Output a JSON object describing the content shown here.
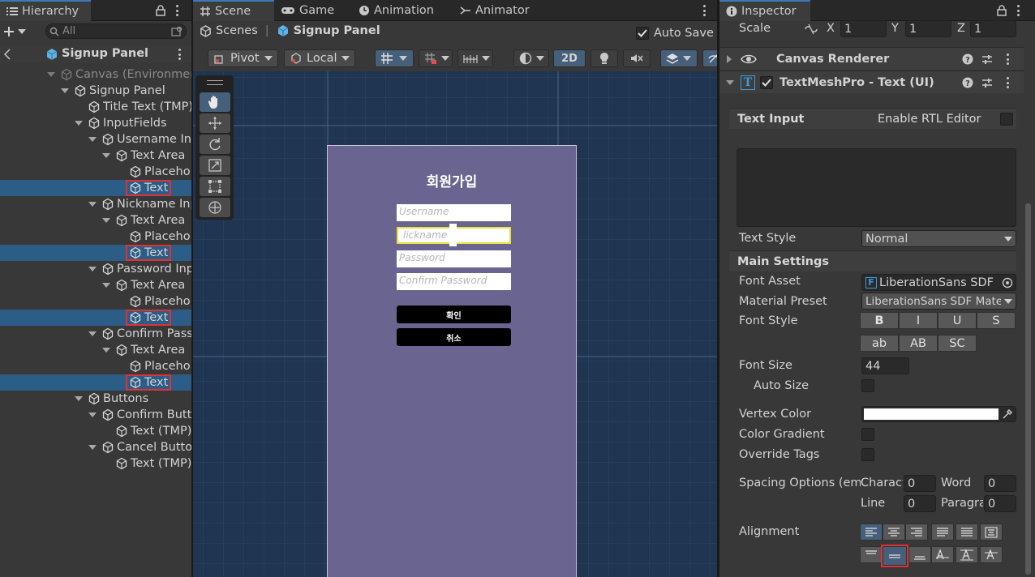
{
  "hierarchy": {
    "tab_label": "Hierarchy",
    "search_placeholder": "All",
    "breadcrumb": "Signup Panel",
    "rows": [
      {
        "label": "Canvas (Environment)",
        "depth": 0
      },
      {
        "label": "Signup Panel",
        "depth": 1
      },
      {
        "label": "Title Text (TMP)",
        "depth": 2
      },
      {
        "label": "InputFields",
        "depth": 2
      },
      {
        "label": "Username Input",
        "depth": 3
      },
      {
        "label": "Text Area",
        "depth": 4
      },
      {
        "label": "Placeholder",
        "depth": 5
      },
      {
        "label": "Text",
        "depth": 5
      },
      {
        "label": "Nickname Input",
        "depth": 3
      },
      {
        "label": "Text Area",
        "depth": 4
      },
      {
        "label": "Placeholder",
        "depth": 5
      },
      {
        "label": "Text",
        "depth": 5
      },
      {
        "label": "Password Input",
        "depth": 3
      },
      {
        "label": "Text Area",
        "depth": 4
      },
      {
        "label": "Placeholder",
        "depth": 5
      },
      {
        "label": "Text",
        "depth": 5
      },
      {
        "label": "Confirm Password",
        "depth": 3
      },
      {
        "label": "Text Area",
        "depth": 4
      },
      {
        "label": "Placeholder",
        "depth": 5
      },
      {
        "label": "Text",
        "depth": 5
      },
      {
        "label": "Buttons",
        "depth": 2
      },
      {
        "label": "Confirm Button",
        "depth": 3
      },
      {
        "label": "Text (TMP)",
        "depth": 4
      },
      {
        "label": "Cancel Button",
        "depth": 3
      },
      {
        "label": "Text (TMP)",
        "depth": 4
      }
    ]
  },
  "scene": {
    "tabs": [
      "Scene",
      "Game",
      "Animation",
      "Animator"
    ],
    "breadcrumb_root": "Scenes",
    "breadcrumb_current": "Signup Panel",
    "auto_save_label": "Auto Save",
    "auto_save_checked": true,
    "pivot_label": "Pivot",
    "local_label": "Local",
    "mode_2d_label": "2D",
    "canvas": {
      "title": "회원가입",
      "inputs": [
        "Username",
        "lickname",
        "Password",
        "Confirm Password"
      ],
      "confirm_button": "확인",
      "cancel_button": "취소"
    }
  },
  "inspector": {
    "tab_label": "Inspector",
    "scale_label": "Scale",
    "scale": {
      "x_label": "X",
      "x": "1",
      "y_label": "Y",
      "y": "1",
      "z_label": "Z",
      "z": "1"
    },
    "canvas_renderer_label": "Canvas Renderer",
    "component_label": "TextMeshPro - Text (UI)",
    "text_input_label": "Text Input",
    "rtl_label": "Enable RTL Editor",
    "text_style_label": "Text Style",
    "text_style_value": "Normal",
    "main_settings_label": "Main Settings",
    "font_asset_label": "Font Asset",
    "font_asset_value": "LiberationSans SDF",
    "material_preset_label": "Material Preset",
    "material_preset_value": "LiberationSans SDF Material",
    "font_style_label": "Font Style",
    "font_style_buttons_row1": [
      "B",
      "I",
      "U",
      "S"
    ],
    "font_style_buttons_row2": [
      "ab",
      "AB",
      "SC"
    ],
    "font_size_label": "Font Size",
    "font_size_value": "44",
    "auto_size_label": "Auto Size",
    "vertex_color_label": "Vertex Color",
    "vertex_color": "#ffffff",
    "color_gradient_label": "Color Gradient",
    "override_tags_label": "Override Tags",
    "spacing_label": "Spacing Options (em)",
    "character_label": "Character",
    "character_value": "0",
    "word_label": "Word",
    "word_value": "0",
    "line_label": "Line",
    "line_value": "0",
    "paragraph_label": "Paragraph",
    "paragraph_value": "0",
    "alignment_label": "Alignment"
  },
  "colors": {
    "selection": "#2c5d87",
    "highlight": "#e03232",
    "canvas_panel": "#6a6590",
    "scene_bg": "#1f3551"
  }
}
